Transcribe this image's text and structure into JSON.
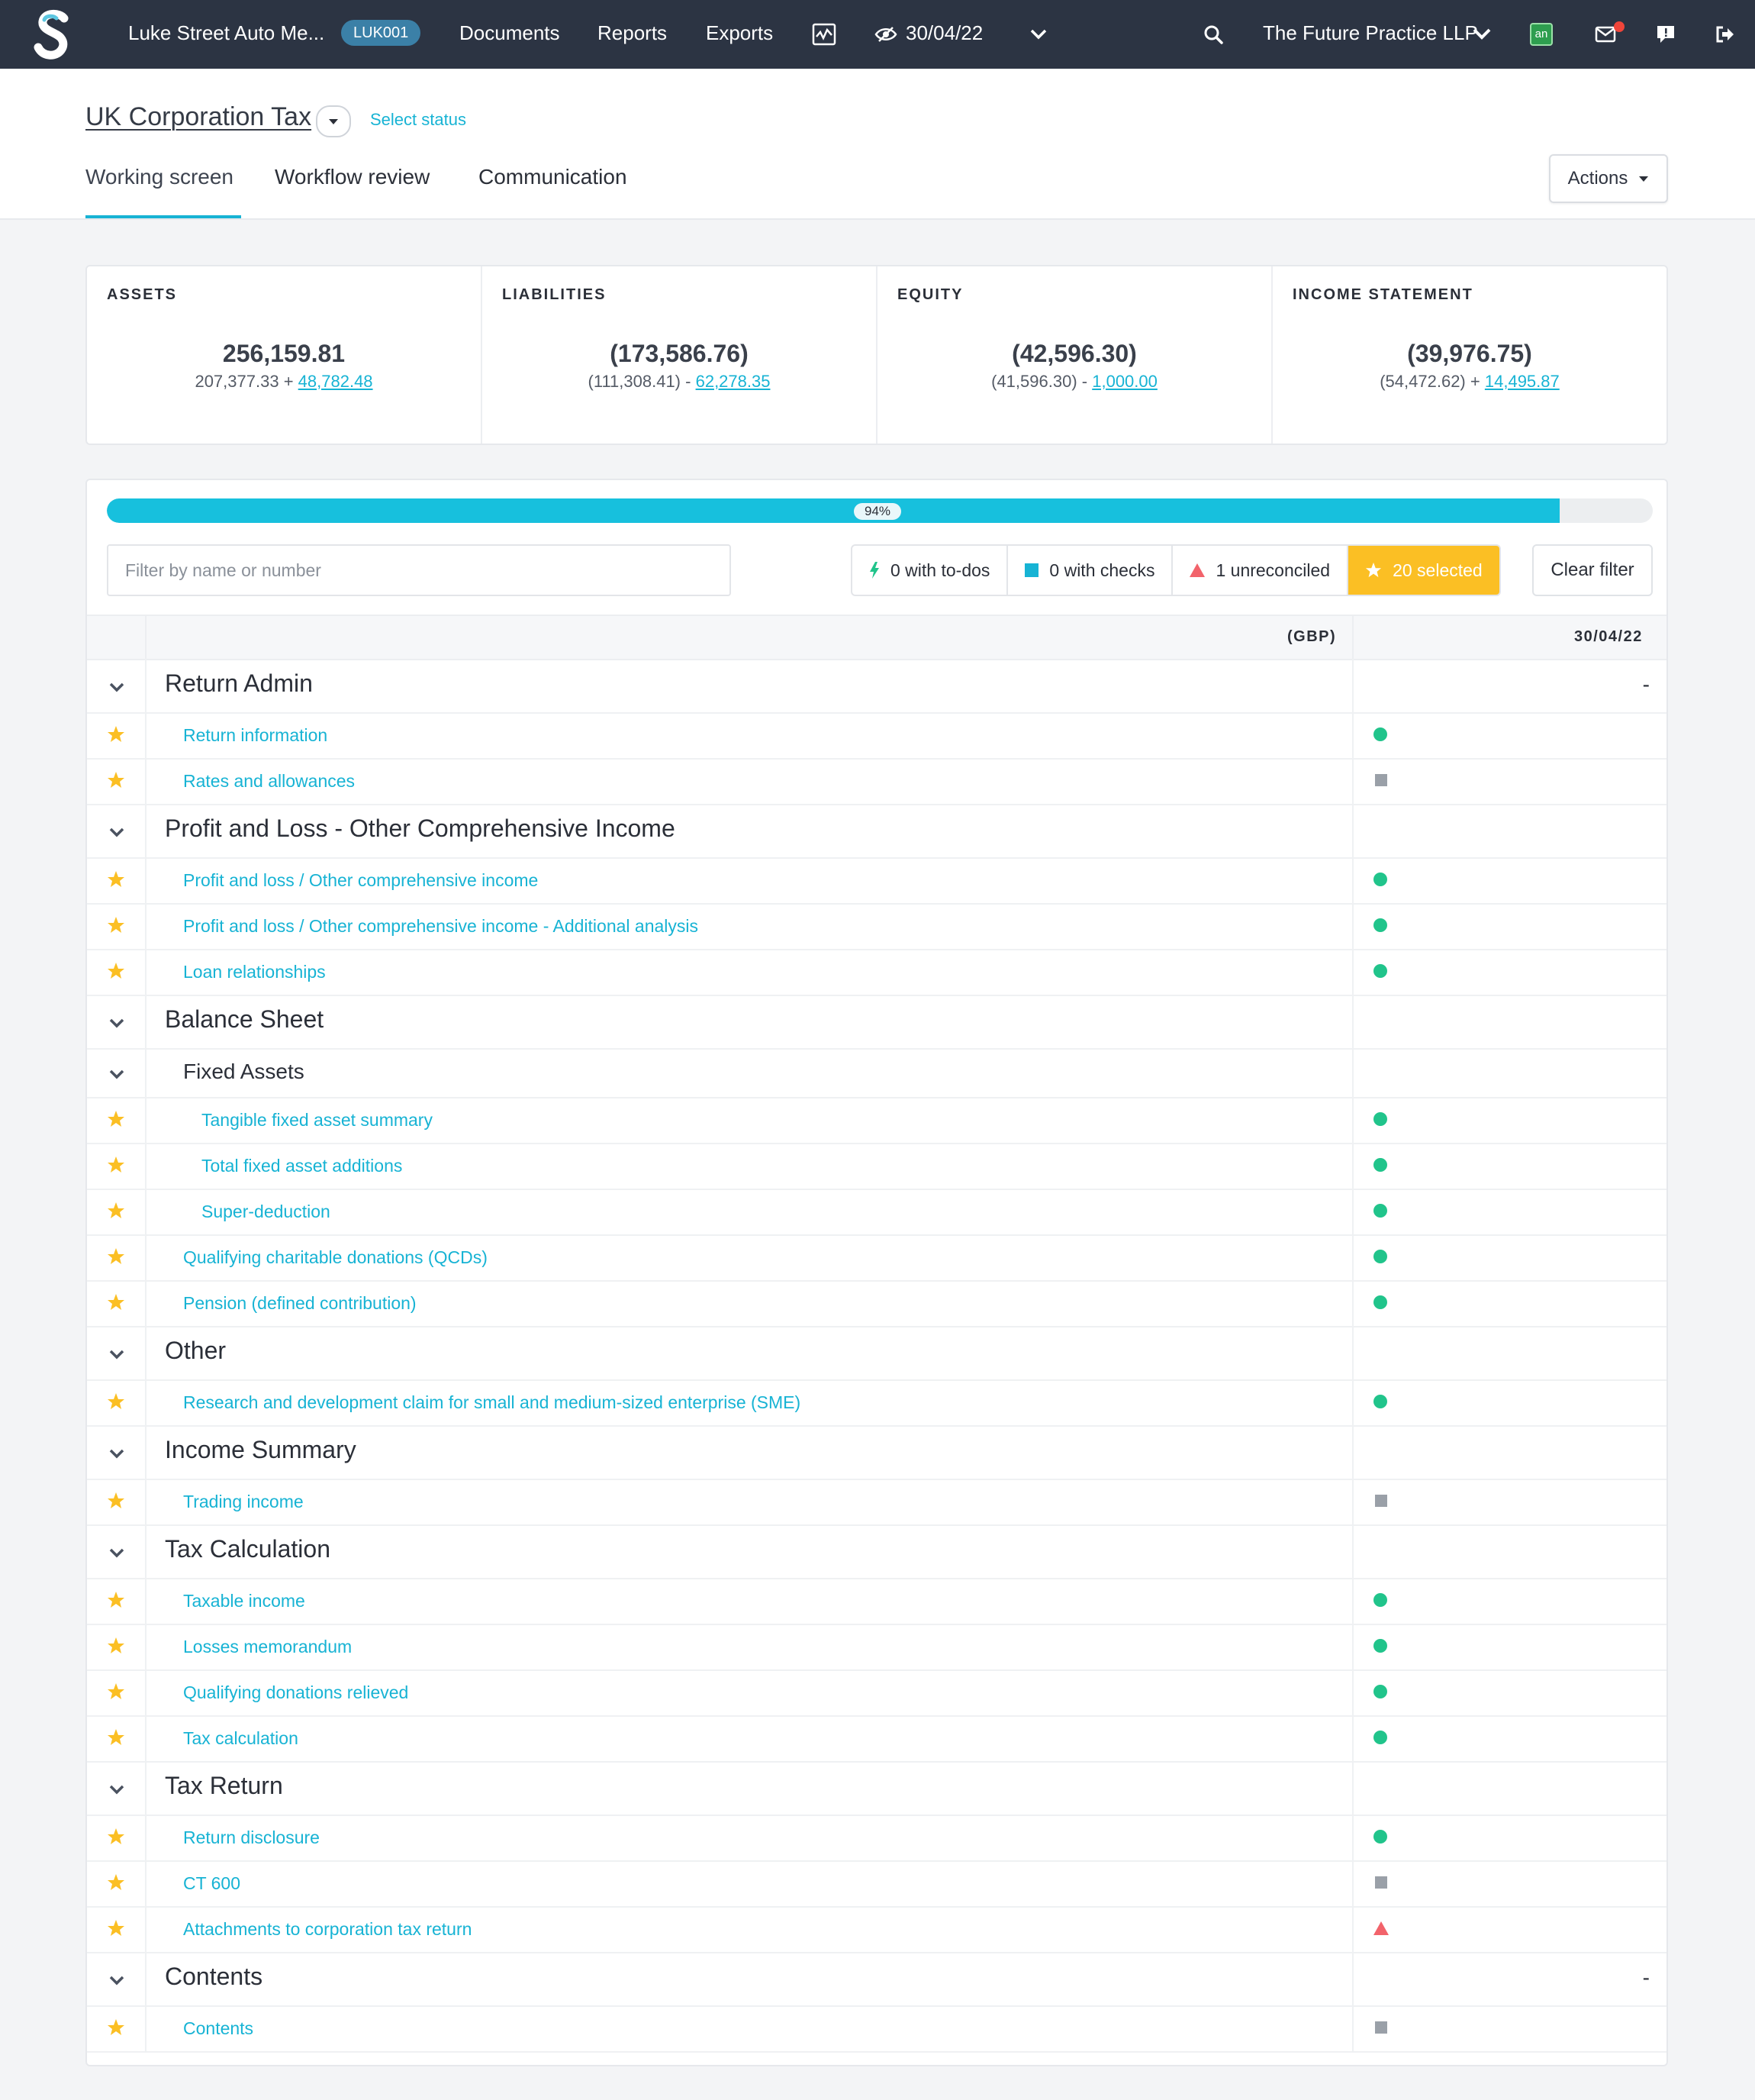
{
  "nav": {
    "client_name": "Luke Street Auto Me...",
    "client_code": "LUK001",
    "links": [
      "Documents",
      "Reports",
      "Exports"
    ],
    "period_date": "30/04/22",
    "practice": "The Future Practice LLP",
    "badge_text": "an"
  },
  "header": {
    "module_title": "UK Corporation Tax",
    "select_status": "Select status",
    "tabs": [
      "Working screen",
      "Workflow review",
      "Communication"
    ],
    "actions_label": "Actions"
  },
  "summary": [
    {
      "label": "ASSETS",
      "total": "256,159.81",
      "base": "207,377.33",
      "op": "+",
      "adjustment": "48,782.48"
    },
    {
      "label": "LIABILITIES",
      "total": "(173,586.76)",
      "base": "(111,308.41)",
      "op": "-",
      "adjustment": "62,278.35"
    },
    {
      "label": "EQUITY",
      "total": "(42,596.30)",
      "base": "(41,596.30)",
      "op": "-",
      "adjustment": "1,000.00"
    },
    {
      "label": "INCOME STATEMENT",
      "total": "(39,976.75)",
      "base": "(54,472.62)",
      "op": "+",
      "adjustment": "14,495.87"
    }
  ],
  "progress": {
    "percent": 94,
    "label": "94%"
  },
  "filter": {
    "placeholder": "Filter by name or number",
    "todos": "0 with to-dos",
    "checks": "0 with checks",
    "unreconciled": "1 unreconciled",
    "selected": "20 selected",
    "clear": "Clear filter"
  },
  "table": {
    "currency_header": "(GBP)",
    "date_header": "30/04/22",
    "rows": [
      {
        "type": "h1",
        "text": "Return Admin",
        "value": "-"
      },
      {
        "type": "item",
        "text": "Return information",
        "status": "dot"
      },
      {
        "type": "item",
        "text": "Rates and allowances",
        "status": "square"
      },
      {
        "type": "h1",
        "text": "Profit and Loss - Other Comprehensive Income"
      },
      {
        "type": "item",
        "text": "Profit and loss / Other comprehensive income",
        "status": "dot"
      },
      {
        "type": "item",
        "text": "Profit and loss / Other comprehensive income - Additional analysis",
        "status": "dot"
      },
      {
        "type": "item",
        "text": "Loan relationships",
        "status": "dot"
      },
      {
        "type": "h1",
        "text": "Balance Sheet"
      },
      {
        "type": "h2",
        "text": "Fixed Assets"
      },
      {
        "type": "item2",
        "text": "Tangible fixed asset summary",
        "status": "dot"
      },
      {
        "type": "item2",
        "text": "Total fixed asset additions",
        "status": "dot"
      },
      {
        "type": "item2",
        "text": "Super-deduction",
        "status": "dot"
      },
      {
        "type": "item",
        "text": "Qualifying charitable donations (QCDs)",
        "status": "dot"
      },
      {
        "type": "item",
        "text": "Pension (defined contribution)",
        "status": "dot"
      },
      {
        "type": "h1",
        "text": "Other"
      },
      {
        "type": "item",
        "text": "Research and development claim for small and medium-sized enterprise (SME)",
        "status": "dot"
      },
      {
        "type": "h1",
        "text": "Income Summary"
      },
      {
        "type": "item",
        "text": "Trading income",
        "status": "square"
      },
      {
        "type": "h1",
        "text": "Tax Calculation"
      },
      {
        "type": "item",
        "text": "Taxable income",
        "status": "dot"
      },
      {
        "type": "item",
        "text": "Losses memorandum",
        "status": "dot"
      },
      {
        "type": "item",
        "text": "Qualifying donations relieved",
        "status": "dot"
      },
      {
        "type": "item",
        "text": "Tax calculation",
        "status": "dot"
      },
      {
        "type": "h1",
        "text": "Tax Return"
      },
      {
        "type": "item",
        "text": "Return disclosure",
        "status": "dot"
      },
      {
        "type": "item",
        "text": "CT 600",
        "status": "square"
      },
      {
        "type": "item",
        "text": "Attachments to corporation tax return",
        "status": "triangle"
      },
      {
        "type": "h1",
        "text": "Contents",
        "value": "-"
      },
      {
        "type": "item",
        "text": "Contents",
        "status": "square"
      }
    ]
  },
  "colors": {
    "nav_bg": "#2c3443",
    "accent": "#17b3d4",
    "progress": "#17c0dd",
    "selected_chip": "#fbbf24",
    "status_ok": "#21c48b",
    "status_unreconciled": "#f2636b",
    "status_none": "#9aa0a8",
    "star": "#fbbf24"
  }
}
